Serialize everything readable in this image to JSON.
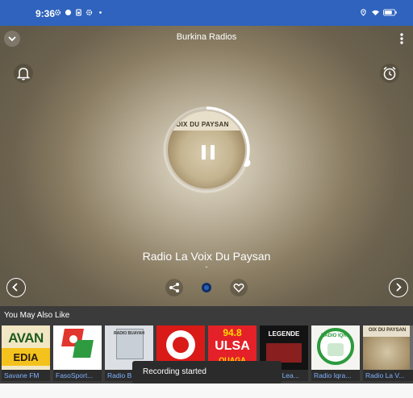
{
  "status_bar": {
    "time": "9:36",
    "left_icons": [
      "gear-icon",
      "circle-icon",
      "clipboard-icon",
      "gear-icon",
      "dot-icon"
    ],
    "right_icons": [
      "location-icon",
      "wifi-icon",
      "battery-icon"
    ],
    "color": "#2f63bd"
  },
  "header": {
    "title": "Burkina Radios",
    "collapse_icon": "chevron-down-icon",
    "menu_icon": "more-vert-icon"
  },
  "player": {
    "notification_icon": "bell-icon",
    "alarm_icon": "alarm-clock-icon",
    "cover_text": "OIX DU PAYSAN",
    "state_icon": "pause-icon",
    "progress": 0.3,
    "station_name": "Radio La Voix Du Paysan",
    "subtitle": "-",
    "controls": [
      "share-icon",
      "record-icon",
      "heart-icon"
    ],
    "prev_icon": "chevron-left-icon",
    "next_icon": "chevron-right-icon"
  },
  "recommendations": {
    "header": "You May Also Like",
    "items": [
      {
        "label": "Savane FM",
        "art_text": "AVAN"
      },
      {
        "label": "FasoSport...",
        "art_text": ""
      },
      {
        "label": "Radio B...",
        "art_text": "RADIO BUAYAH"
      },
      {
        "label": "",
        "art_text": ""
      },
      {
        "label": "",
        "art_text": "94.8"
      },
      {
        "label": "Radio Lea...",
        "art_text": "LEGENDE"
      },
      {
        "label": "Radio Iqra...",
        "art_text": "RADIO IQRA"
      },
      {
        "label": "Radio La V...",
        "art_text": "OIX DU PAYSAN"
      },
      {
        "label": "",
        "art_text": ""
      }
    ]
  },
  "toast": {
    "message": "Recording started"
  }
}
